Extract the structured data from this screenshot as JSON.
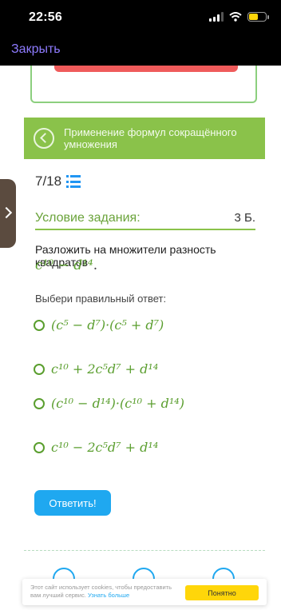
{
  "status_bar": {
    "time": "22:56"
  },
  "nav": {
    "close_label": "Закрыть"
  },
  "topic": {
    "title": "Применение формул сокращённого умножения"
  },
  "task": {
    "counter": "7/18",
    "condition_label": "Условие задания:",
    "points": "3 Б.",
    "text": "Разложить на множители разность квадратов",
    "expression": "c¹⁰ − d¹⁴",
    "prompt": "Выбери правильный ответ:"
  },
  "options": [
    "(c⁵ − d⁷)·(c⁵ + d⁷)",
    "c¹⁰ + 2c⁵d⁷ + d¹⁴",
    "(c¹⁰ − d¹⁴)·(c¹⁰ + d¹⁴)",
    "c¹⁰ − 2c⁵d⁷ + d¹⁴"
  ],
  "answer_button": "Ответить!",
  "cookie": {
    "text": "Этот сайт использует cookies, чтобы предоставить вам лучший сервис.",
    "link": "Узнать больше",
    "accept": "Понятно"
  },
  "colors": {
    "accent_green": "#8ac24a",
    "math_green": "#5a9e2e",
    "button_blue": "#1fa8f0",
    "cookie_yellow": "#ffd60a"
  },
  "icons": [
    "cellular-signal-icon",
    "wifi-icon",
    "battery-icon",
    "back-circle-icon",
    "list-icon",
    "chevron-right-icon"
  ]
}
